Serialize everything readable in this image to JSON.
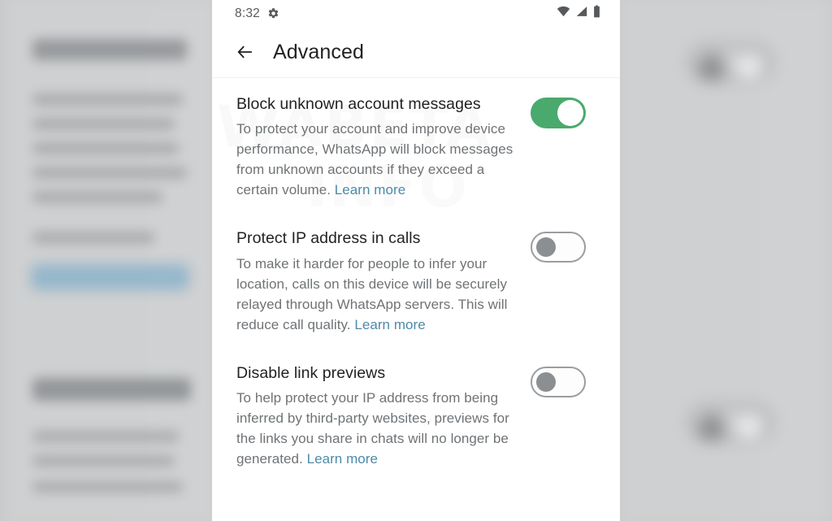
{
  "status_bar": {
    "time": "8:32",
    "icons": [
      "gear-icon",
      "wifi-icon",
      "cellular-signal-icon",
      "battery-icon"
    ]
  },
  "app_bar": {
    "back_label": "back-arrow-icon",
    "title": "Advanced"
  },
  "watermark": {
    "line1": "WABETA",
    "line2": "INFO"
  },
  "colors": {
    "toggle_on": "#4aa96c",
    "toggle_off_border": "#9a9da0",
    "toggle_off_knob": "#8b8f92",
    "link": "#4d8aa8",
    "title_text": "#1f2123",
    "body_text": "#6f7376",
    "panel_bg": "#ffffff",
    "backdrop": "#cbcccd"
  },
  "settings": [
    {
      "id": "block-unknown-account-messages",
      "title": "Block unknown account messages",
      "description": "To protect your account and improve device performance, WhatsApp will block messages from unknown accounts if they exceed a certain volume. ",
      "link_label": "Learn more",
      "toggle_state": "on"
    },
    {
      "id": "protect-ip-address-in-calls",
      "title": "Protect IP address in calls",
      "description": "To make it harder for people to infer your location, calls on this device will be securely relayed through WhatsApp servers. This will reduce call quality. ",
      "link_label": "Learn more",
      "toggle_state": "off"
    },
    {
      "id": "disable-link-previews",
      "title": "Disable link previews",
      "description": "To help protect your IP address from being inferred by third-party websites, previews for the links you share in chats will no longer be generated. ",
      "link_label": "Learn more",
      "toggle_state": "off"
    }
  ]
}
